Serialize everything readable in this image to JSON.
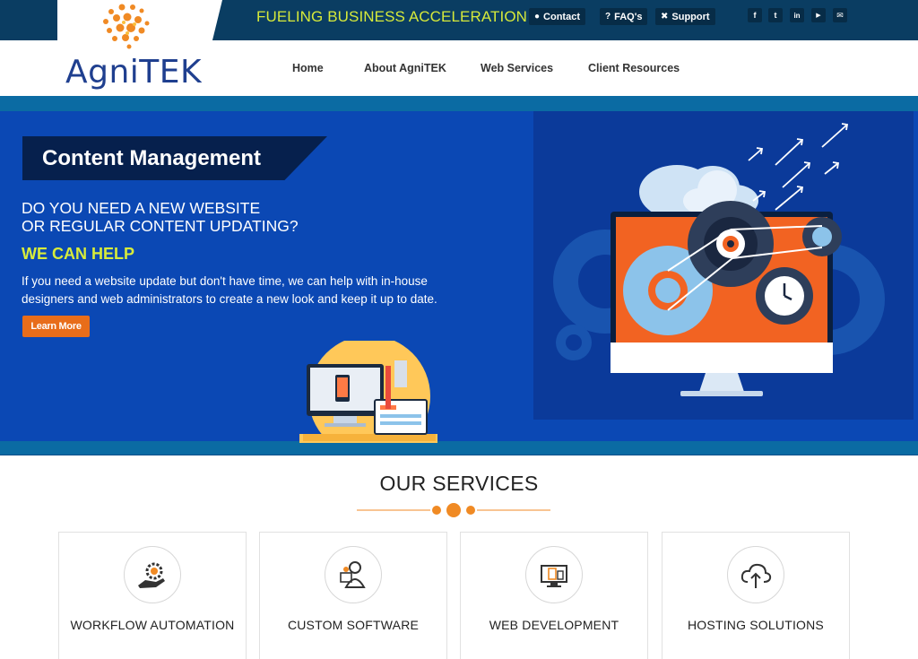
{
  "topbar": {
    "tagline": "FUELING BUSINESS ACCELERATION",
    "links": [
      {
        "label": "Contact",
        "icon": "chat-icon"
      },
      {
        "label": "FAQ's",
        "icon": "question-icon"
      },
      {
        "label": "Support",
        "icon": "wrench-icon"
      }
    ],
    "social": [
      {
        "glyph": "f",
        "icon": "facebook-icon"
      },
      {
        "glyph": "t",
        "icon": "twitter-icon"
      },
      {
        "glyph": "in",
        "icon": "linkedin-icon"
      },
      {
        "glyph": "▶",
        "icon": "youtube-icon"
      },
      {
        "glyph": "✉",
        "icon": "email-icon"
      }
    ]
  },
  "brand": {
    "name": "AgniTEK",
    "accent": "#f08a24",
    "primary": "#1f3f8f"
  },
  "nav": {
    "items": [
      "Home",
      "About AgniTEK",
      "Web Services",
      "Client Resources"
    ]
  },
  "hero": {
    "title": "Content Management",
    "question_line1": "DO YOU NEED A NEW WEBSITE",
    "question_line2": "OR REGULAR CONTENT UPDATING?",
    "help": "WE CAN HELP",
    "body": "If you need a website update but don't have time, we can help with in-house designers and web administrators to create a new look and keep it up to date.",
    "cta": "Learn More"
  },
  "services": {
    "title": "OUR SERVICES",
    "items": [
      {
        "label": "WORKFLOW AUTOMATION",
        "icon": "gear-hand-icon"
      },
      {
        "label": "CUSTOM SOFTWARE",
        "icon": "developer-icon"
      },
      {
        "label": "WEB DEVELOPMENT",
        "icon": "devices-icon"
      },
      {
        "label": "HOSTING SOLUTIONS",
        "icon": "cloud-upload-icon"
      }
    ]
  },
  "colors": {
    "topbar": "#0a3d62",
    "hero": "#0b48b4",
    "tagline": "#d6e93a",
    "cta": "#e86d1a"
  }
}
